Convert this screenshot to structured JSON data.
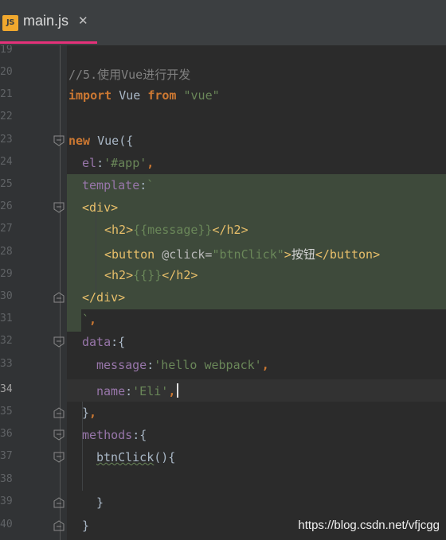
{
  "tab": {
    "icon_label": "JS",
    "file_name": "main.js",
    "close_glyph": "✕"
  },
  "lines": [
    {
      "no": "19",
      "text": ""
    },
    {
      "no": "20",
      "text": "//5.使用Vue进行开发"
    },
    {
      "no": "21",
      "text": "import Vue from \"vue\""
    },
    {
      "no": "22",
      "text": ""
    },
    {
      "no": "23",
      "text": "new Vue({"
    },
    {
      "no": "24",
      "text": "el:'#app',"
    },
    {
      "no": "25",
      "text": "template:`"
    },
    {
      "no": "26",
      "text": "<div>"
    },
    {
      "no": "27",
      "text": "<h2>{{message}}</h2>"
    },
    {
      "no": "28",
      "text": "<button @click=\"btnClick\">按钮</button>"
    },
    {
      "no": "29",
      "text": "<h2>{{}}</h2>"
    },
    {
      "no": "30",
      "text": "</div>"
    },
    {
      "no": "31",
      "text": "`,"
    },
    {
      "no": "32",
      "text": "data:{"
    },
    {
      "no": "33",
      "text": "message:'hello webpack',"
    },
    {
      "no": "34",
      "text": "name:'Eli',"
    },
    {
      "no": "35",
      "text": "},"
    },
    {
      "no": "36",
      "text": "methods:{"
    },
    {
      "no": "37",
      "text": "btnClick(){"
    },
    {
      "no": "38",
      "text": ""
    },
    {
      "no": "39",
      "text": "}"
    },
    {
      "no": "40",
      "text": "}"
    }
  ],
  "active_line": "34",
  "watermark": "https://blog.csdn.net/vfjcgg",
  "colors": {
    "keyword": "#cc7832",
    "string": "#6a8759",
    "comment": "#808080",
    "property": "#9876aa",
    "tag": "#e8bf6a",
    "text": "#a9b7c6",
    "template_bg": "#3e4a3b",
    "tab_accent": "#e5317a"
  }
}
